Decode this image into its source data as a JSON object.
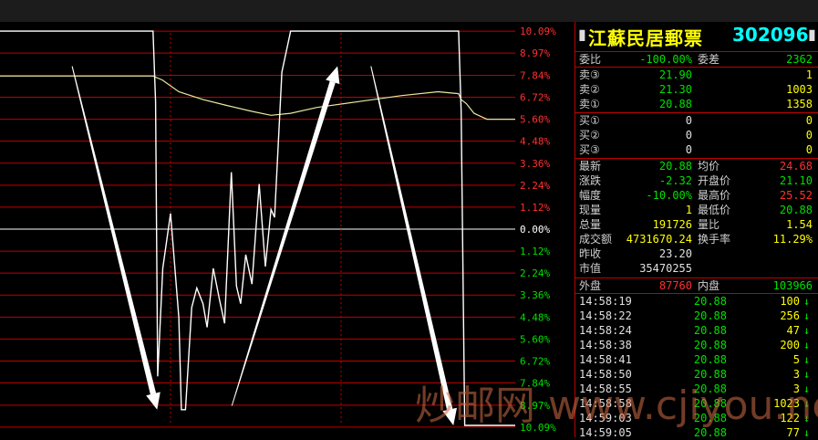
{
  "stock": {
    "name": "江蘇民居郵票",
    "code": "302096",
    "mark": "▮",
    "mark2": "▮"
  },
  "quote": {
    "webi_label": "委比",
    "webi_value": "-100.00%",
    "weicha_label": "委差",
    "weicha_value": "2362",
    "asks": [
      {
        "label": "卖③",
        "price": "21.90",
        "vol": "1"
      },
      {
        "label": "卖②",
        "price": "21.30",
        "vol": "1003"
      },
      {
        "label": "卖①",
        "price": "20.88",
        "vol": "1358"
      }
    ],
    "bids": [
      {
        "label": "买①",
        "price": "0",
        "vol": "0"
      },
      {
        "label": "买②",
        "price": "0",
        "vol": "0"
      },
      {
        "label": "买③",
        "price": "0",
        "vol": "0"
      }
    ],
    "stats": [
      {
        "l1": "最新",
        "v1": "20.88",
        "l2": "均价",
        "v2": "24.68"
      },
      {
        "l1": "涨跌",
        "v1": "-2.32",
        "l2": "开盘价",
        "v2": "21.10"
      },
      {
        "l1": "幅度",
        "v1": "-10.00%",
        "l2": "最高价",
        "v2": "25.52"
      },
      {
        "l1": "现量",
        "v1": "1",
        "l2": "最低价",
        "v2": "20.88"
      },
      {
        "l1": "总量",
        "v1": "191726",
        "l2": "量比",
        "v2": "1.54"
      },
      {
        "l1": "成交额",
        "v1": "4731670.24",
        "l2": "换手率",
        "v2": "11.29%"
      },
      {
        "l1": "昨收",
        "v1": "23.20",
        "l2": "",
        "v2": ""
      },
      {
        "l1": "市值",
        "v1": "35470255",
        "l2": "",
        "v2": ""
      }
    ],
    "outer_label": "外盘",
    "outer_value": "87760",
    "inner_label": "内盘",
    "inner_value": "103966"
  },
  "ticks": [
    {
      "time": "14:58:19",
      "price": "20.88",
      "vol": "100",
      "arrow": "↓"
    },
    {
      "time": "14:58:22",
      "price": "20.88",
      "vol": "256",
      "arrow": "↓"
    },
    {
      "time": "14:58:24",
      "price": "20.88",
      "vol": "47",
      "arrow": "↓"
    },
    {
      "time": "14:58:38",
      "price": "20.88",
      "vol": "200",
      "arrow": "↓"
    },
    {
      "time": "14:58:41",
      "price": "20.88",
      "vol": "5",
      "arrow": "↓"
    },
    {
      "time": "14:58:50",
      "price": "20.88",
      "vol": "3",
      "arrow": "↓"
    },
    {
      "time": "14:58:55",
      "price": "20.88",
      "vol": "3",
      "arrow": "↓"
    },
    {
      "time": "14:58:58",
      "price": "20.88",
      "vol": "1023",
      "arrow": "↓"
    },
    {
      "time": "14:59:03",
      "price": "20.88",
      "vol": "122",
      "arrow": "↓"
    },
    {
      "time": "14:59:05",
      "price": "20.88",
      "vol": "77",
      "arrow": "↓"
    }
  ],
  "watermark": "炒邮网 www.cjiyou.net",
  "colors": {
    "grid": "#c00000",
    "up": "#ff3030",
    "down": "#00e000",
    "price_line": "#ffffff",
    "avg_line": "#e8e8a0",
    "zero": "#ffffff"
  },
  "chart_data": {
    "type": "line",
    "prev_close": 23.2,
    "ylim_pct": [
      -10,
      10
    ],
    "tick_labels_up": [
      "10.09%",
      "8.97%",
      "7.84%",
      "6.72%",
      "5.60%",
      "4.48%",
      "3.36%",
      "2.24%",
      "1.12%"
    ],
    "tick_label_zero": "0.00%",
    "tick_labels_down": [
      "1.12%",
      "2.24%",
      "3.36%",
      "4.48%",
      "5.60%",
      "6.72%",
      "7.84%",
      "8.97%",
      "10.09%"
    ],
    "tick_values_pct": [
      10.09,
      8.97,
      7.84,
      6.72,
      5.6,
      4.48,
      3.36,
      2.24,
      1.12,
      0,
      -1.12,
      -2.24,
      -3.36,
      -4.48,
      -5.6,
      -6.72,
      -7.84,
      -8.97,
      -10.09
    ],
    "x_range": [
      0,
      100
    ],
    "series": [
      {
        "key": "price",
        "x": [
          0,
          29.7,
          30.2,
          30.6,
          31.6,
          33.1,
          34.7,
          35.2,
          36.0,
          37.2,
          38.2,
          39.4,
          40.2,
          41.4,
          42.6,
          43.6,
          44.9,
          45.9,
          46.7,
          47.7,
          48.9,
          50.3,
          51.5,
          52.6,
          53.3,
          54.7,
          56.4,
          89.0,
          89.5,
          90.2,
          100
        ],
        "y": [
          10.09,
          10.09,
          6.5,
          -7.5,
          -2.0,
          0.8,
          -4.5,
          -9.2,
          -9.2,
          -4.0,
          -3.0,
          -3.8,
          -5.0,
          -2.0,
          -3.6,
          -4.8,
          2.9,
          -2.9,
          -3.8,
          -1.3,
          -2.8,
          2.3,
          -1.9,
          1.0,
          0.6,
          8.0,
          10.09,
          10.09,
          6.0,
          -10.0,
          -10.0
        ]
      },
      {
        "key": "avg",
        "x": [
          0,
          29.7,
          31.5,
          34.7,
          39.4,
          44.0,
          48.9,
          52.6,
          56.4,
          61.5,
          69.6,
          77.8,
          85.0,
          89.0,
          89.5,
          90.5,
          92.0,
          94.5,
          100
        ],
        "y": [
          7.8,
          7.8,
          7.6,
          7.0,
          6.6,
          6.3,
          6.0,
          5.8,
          5.9,
          6.2,
          6.5,
          6.8,
          7.0,
          6.9,
          6.6,
          6.4,
          5.9,
          5.6,
          5.6
        ]
      }
    ],
    "annotations": [
      {
        "type": "arrow",
        "x1": 14.0,
        "y1": 8.3,
        "x2": 30.5,
        "y2": -9.2
      },
      {
        "type": "arrow",
        "x1": 45.0,
        "y1": -9.0,
        "x2": 65.5,
        "y2": 8.3
      },
      {
        "type": "arrow",
        "x1": 72.0,
        "y1": 8.3,
        "x2": 88.0,
        "y2": -10.0
      }
    ]
  }
}
